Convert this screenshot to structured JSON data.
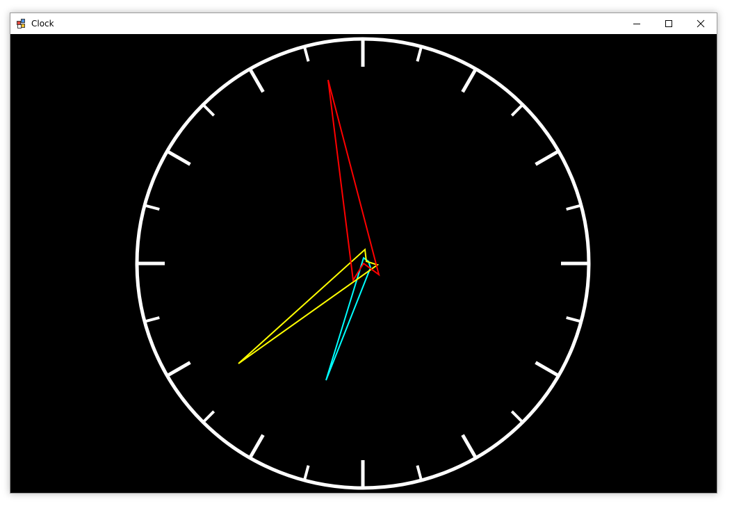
{
  "window": {
    "title": "Clock",
    "app_icon": "windows-form-icon",
    "controls": [
      "minimize-icon",
      "maximize-icon",
      "close-icon"
    ]
  },
  "clock": {
    "background": "#000000",
    "dial_color": "#ffffff",
    "tick_marks": 24,
    "hands": [
      {
        "name": "hour-hand",
        "color": "#00ffff"
      },
      {
        "name": "minute-hand",
        "color": "#ffff00"
      },
      {
        "name": "second-hand",
        "color": "#ff0000"
      }
    ]
  }
}
